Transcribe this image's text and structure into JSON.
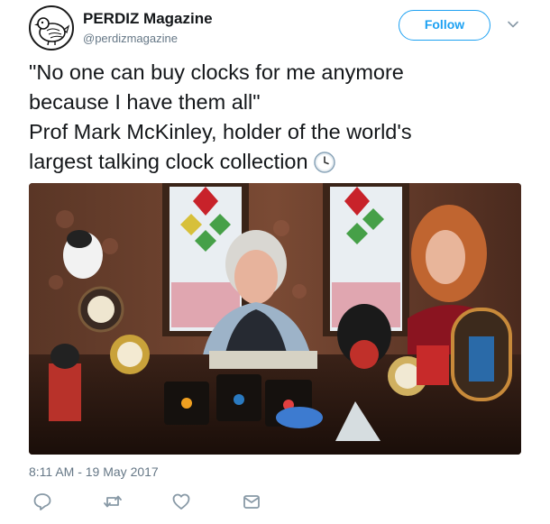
{
  "account": {
    "name": "PERDIZ Magazine",
    "handle": "@perdizmagazine",
    "avatar_icon": "partridge-icon"
  },
  "follow_button": {
    "label": "Follow"
  },
  "menu": {
    "icon": "chevron-down-icon"
  },
  "tweet": {
    "lines": [
      "\"No one can buy clocks for me anymore",
      "because I have them all\"",
      "Prof Mark McKinley, holder of the world's",
      "largest talking clock collection"
    ],
    "emoji_icon": "clock-face-nine-oclock-icon"
  },
  "media": {
    "image_icon": "photo-icon"
  },
  "timestamp": "8:11 AM - 19 May 2017",
  "actions": [
    {
      "name": "reply",
      "icon": "reply-icon"
    },
    {
      "name": "retweet",
      "icon": "retweet-icon"
    },
    {
      "name": "like",
      "icon": "heart-icon"
    },
    {
      "name": "direct-message",
      "icon": "envelope-icon"
    }
  ],
  "colors": {
    "accent": "#1da1f2",
    "text": "#14171a",
    "secondary": "#657786",
    "icon_gray": "#8899a6"
  }
}
